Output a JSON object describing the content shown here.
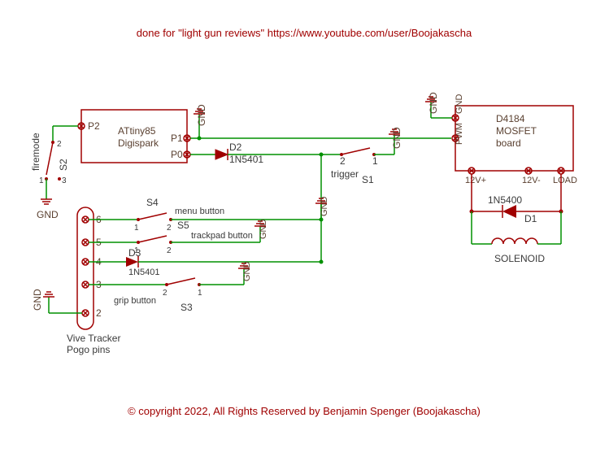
{
  "header": {
    "text": "done for \"light gun reviews\" https://www.youtube.com/user/Boojakascha"
  },
  "footer": {
    "text": "© copyright 2022, All Rights Reserved by Benjamin Spenger (Boojakascha)"
  },
  "components": {
    "attiny": {
      "line1": "ATtiny85",
      "line2": "Digispark"
    },
    "attiny_pins": {
      "p0": "P0",
      "p1": "P1",
      "p2": "P2"
    },
    "mosfet": {
      "line1": "D4184",
      "line2": "MOSFET",
      "line3": "board"
    },
    "mosfet_pins": {
      "gnd": "GND",
      "pwm": "PWM",
      "v12p": "12V+",
      "v12n": "12V-",
      "load": "LOAD"
    },
    "d1": {
      "ref": "D1",
      "val": "1N5400"
    },
    "d2": {
      "ref": "D2",
      "val": "1N5401"
    },
    "d3": {
      "ref": "D3",
      "val": "1N5401"
    },
    "s1": {
      "ref": "S1",
      "label": "trigger"
    },
    "s2": {
      "ref": "S2",
      "label": "firemode"
    },
    "s3": {
      "ref": "S3",
      "label": "grip button"
    },
    "s4": {
      "ref": "S4",
      "label": "menu button"
    },
    "s5": {
      "ref": "S5",
      "label": "trackpad button"
    },
    "solenoid": "SOLENOID",
    "vive": {
      "line1": "Vive Tracker",
      "line2": "Pogo pins"
    },
    "pogo": {
      "p2": "2",
      "p3": "3",
      "p4": "4",
      "p5": "5",
      "p6": "6"
    },
    "sw_pins": {
      "one": "1",
      "two": "2",
      "three": "3"
    },
    "gnd": "GND"
  }
}
